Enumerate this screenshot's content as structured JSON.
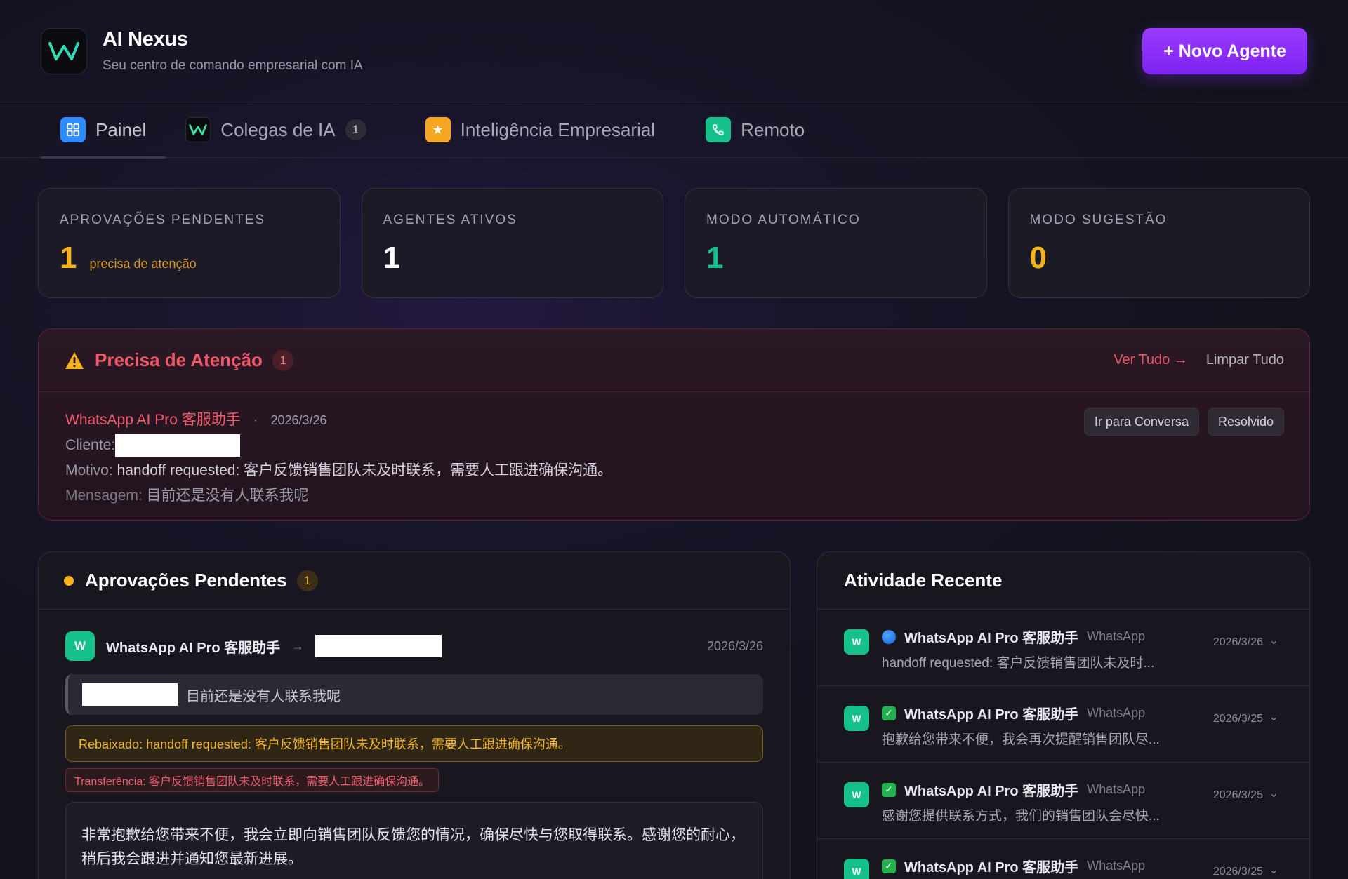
{
  "header": {
    "title": "AI Nexus",
    "subtitle": "Seu centro de comando empresarial com IA",
    "new_agent_label": "+ Novo Agente"
  },
  "tabs": [
    {
      "label": "Painel",
      "icon": "grid-icon",
      "color": "#2f8cff"
    },
    {
      "label": "Colegas de IA",
      "icon": "w-logo-icon",
      "badge": "1"
    },
    {
      "label": "Inteligência Empresarial",
      "icon": "star-icon",
      "color": "#f5a623"
    },
    {
      "label": "Remoto",
      "icon": "phone-icon",
      "color": "#16c08a"
    }
  ],
  "stats": [
    {
      "label": "APROVAÇÕES PENDENTES",
      "value": "1",
      "note": "precisa de atenção",
      "color": "#f5b21b"
    },
    {
      "label": "AGENTES ATIVOS",
      "value": "1",
      "color": "#ffffff"
    },
    {
      "label": "MODO AUTOMÁTICO",
      "value": "1",
      "color": "#16c08a"
    },
    {
      "label": "MODO SUGESTÃO",
      "value": "0",
      "color": "#f5b21b"
    }
  ],
  "attention": {
    "title": "Precisa de Atenção",
    "count": "1",
    "view_all": "Ver Tudo →",
    "clear_all": "Limpar Tudo",
    "item": {
      "agent": "WhatsApp AI Pro 客服助手",
      "separator": "·",
      "date": "2026/3/26",
      "client_label": "Cliente:",
      "reason_label": "Motivo:",
      "reason": "handoff requested: 客户反馈销售团队未及时联系，需要人工跟进确保沟通。",
      "message_label": "Mensagem:",
      "message": "目前还是没有人联系我呢",
      "goto_label": "Ir para Conversa",
      "resolved_label": "Resolvido"
    }
  },
  "pending": {
    "title": "Aprovações Pendentes",
    "count": "1",
    "item": {
      "avatar": "W",
      "agent": "WhatsApp AI Pro 客服助手",
      "arrow": "→",
      "date": "2026/3/26",
      "message": "目前还是没有人联系我呢",
      "downgrade": "Rebaixado: handoff requested: 客户反馈销售团队未及时联系，需要人工跟进确保沟通。",
      "transfer": "Transferência: 客户反馈销售团队未及时联系，需要人工跟进确保沟通。",
      "reply": "非常抱歉给您带来不便，我会立即向销售团队反馈您的情况，确保尽快与您取得联系。感谢您的耐心，稍后我会跟进并通知您最新进展。"
    }
  },
  "activity": {
    "title": "Atividade Recente",
    "items": [
      {
        "status": "blue-circle",
        "agent": "WhatsApp AI Pro 客服助手",
        "channel": "WhatsApp",
        "preview": "handoff requested: 客户反馈销售团队未及时...",
        "date": "2026/3/26"
      },
      {
        "status": "check",
        "agent": "WhatsApp AI Pro 客服助手",
        "channel": "WhatsApp",
        "preview": "抱歉给您带来不便，我会再次提醒销售团队尽...",
        "date": "2026/3/25"
      },
      {
        "status": "check",
        "agent": "WhatsApp AI Pro 客服助手",
        "channel": "WhatsApp",
        "preview": "感谢您提供联系方式，我们的销售团队会尽快...",
        "date": "2026/3/25"
      },
      {
        "status": "check",
        "agent": "WhatsApp AI Pro 客服助手",
        "channel": "WhatsApp",
        "preview": "",
        "date": "2026/3/25"
      }
    ]
  }
}
